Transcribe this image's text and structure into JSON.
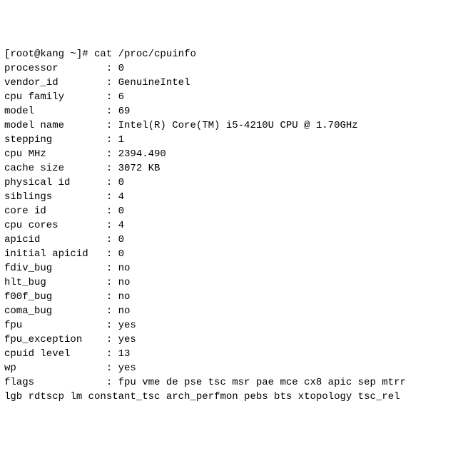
{
  "prompt": "[root@kang ~]# cat /proc/cpuinfo",
  "fields": [
    {
      "key": "processor",
      "sep": ": ",
      "val": "0"
    },
    {
      "key": "vendor_id",
      "sep": ": ",
      "val": "GenuineIntel"
    },
    {
      "key": "cpu family",
      "sep": ": ",
      "val": "6"
    },
    {
      "key": "model",
      "sep": ": ",
      "val": "69"
    },
    {
      "key": "model name",
      "sep": ": ",
      "val": "Intel(R) Core(TM) i5-4210U CPU @ 1.70GHz"
    },
    {
      "key": "stepping",
      "sep": ": ",
      "val": "1"
    },
    {
      "key": "cpu MHz",
      "sep": ": ",
      "val": "2394.490"
    },
    {
      "key": "cache size",
      "sep": ": ",
      "val": "3072 KB"
    },
    {
      "key": "physical id",
      "sep": ": ",
      "val": "0"
    },
    {
      "key": "siblings",
      "sep": ": ",
      "val": "4"
    },
    {
      "key": "core id",
      "sep": ": ",
      "val": "0"
    },
    {
      "key": "cpu cores",
      "sep": ": ",
      "val": "4"
    },
    {
      "key": "apicid",
      "sep": ": ",
      "val": "0"
    },
    {
      "key": "initial apicid",
      "sep": ": ",
      "val": "0"
    },
    {
      "key": "fdiv_bug",
      "sep": ": ",
      "val": "no"
    },
    {
      "key": "hlt_bug",
      "sep": ": ",
      "val": "no"
    },
    {
      "key": "f00f_bug",
      "sep": ": ",
      "val": "no"
    },
    {
      "key": "coma_bug",
      "sep": ": ",
      "val": "no"
    },
    {
      "key": "fpu",
      "sep": ": ",
      "val": "yes"
    },
    {
      "key": "fpu_exception",
      "sep": ": ",
      "val": "yes"
    },
    {
      "key": "cpuid level",
      "sep": ": ",
      "val": "13"
    },
    {
      "key": "wp",
      "sep": ": ",
      "val": "yes"
    },
    {
      "key": "flags",
      "sep": ": ",
      "val": "fpu vme de pse tsc msr pae mce cx8 apic sep mtrr"
    }
  ],
  "flags_wrap": "lgb rdtscp lm constant_tsc arch_perfmon pebs bts xtopology tsc_rel"
}
